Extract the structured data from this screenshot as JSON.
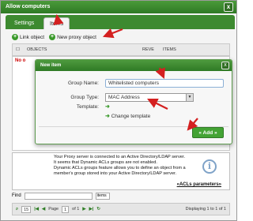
{
  "window": {
    "title": "Allow computers",
    "close_glyph": "x"
  },
  "tabs": [
    {
      "label": "Settings"
    },
    {
      "label": "Items"
    }
  ],
  "toolbar": {
    "link_object": "Link object",
    "new_proxy_object": "New proxy object"
  },
  "grid": {
    "headers": [
      "OBJECTS",
      "REVE",
      "ITEMS"
    ],
    "empty_text": "No o"
  },
  "modal": {
    "title": "New item",
    "close_glyph": "x",
    "group_name_label": "Group Name:",
    "group_name_value": "Whitelisted computers",
    "group_type_label": "Group Type:",
    "group_type_value": "MAC Address",
    "template_label": "Template:",
    "change_template": "Change template",
    "add_button": "« Add »"
  },
  "info": {
    "lines": [
      "Your Proxy server is connected to an Active Directory/LDAP server.",
      "It seems that Dynamic ACLs groups are not enabled.",
      "Dynamic ACLs groups feature allows you to define an object from a member's group stored into your Active Directory/LDAP server."
    ],
    "link": "«ACLs parameters»",
    "icon_glyph": "i"
  },
  "find": {
    "label": "Find",
    "select_value": "items"
  },
  "pager": {
    "page_size": "15",
    "page_label": "Page",
    "page_value": "1",
    "of_label": "of 1",
    "display": "Displaying 1 to 1 of 1"
  },
  "colors": {
    "accent": "#3d8a30",
    "annotation": "#d42020"
  }
}
